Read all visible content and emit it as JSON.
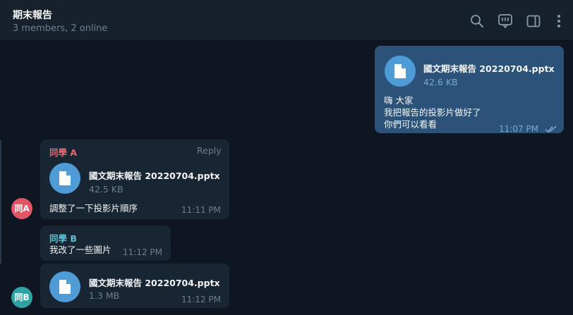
{
  "header": {
    "title": "期末報告",
    "subtitle": "3 members, 2 online",
    "icons": [
      "search-icon",
      "discussion-icon",
      "sidebar-toggle-icon",
      "more-vertical-icon"
    ]
  },
  "messages": {
    "outgoing": {
      "file_name": "國文期末報告 20220704.pptx",
      "file_size": "42.6 KB",
      "lines": [
        "嗨 大家",
        "我把報告的投影片做好了",
        "你們可以看看"
      ],
      "time": "11:07 PM",
      "status_icon": "double-check-icon"
    },
    "a": {
      "sender": "同學 A",
      "reply_label": "Reply",
      "file_name": "國文期末報告 20220704.pptx",
      "file_size": "42.5 KB",
      "text": "調整了一下投影片順序",
      "time": "11:11 PM",
      "avatar": "同A"
    },
    "b_text": {
      "sender": "同學 B",
      "text": "我改了一些圖片",
      "time": "11:12 PM"
    },
    "b_file": {
      "file_name": "國文期末報告 20220704.pptx",
      "file_size": "1.3 MB",
      "time": "11:12 PM",
      "avatar": "同B"
    }
  },
  "colors": {
    "background": "#0e1621",
    "header": "#17212b",
    "outgoing_bubble": "#2b5278",
    "incoming_bubble": "#182533",
    "file_icon": "#4e9bd6",
    "sender_a": "#e66a73",
    "sender_b": "#5bc3d8",
    "avatar_a": "#e05566",
    "avatar_b": "#2fa3a3"
  }
}
